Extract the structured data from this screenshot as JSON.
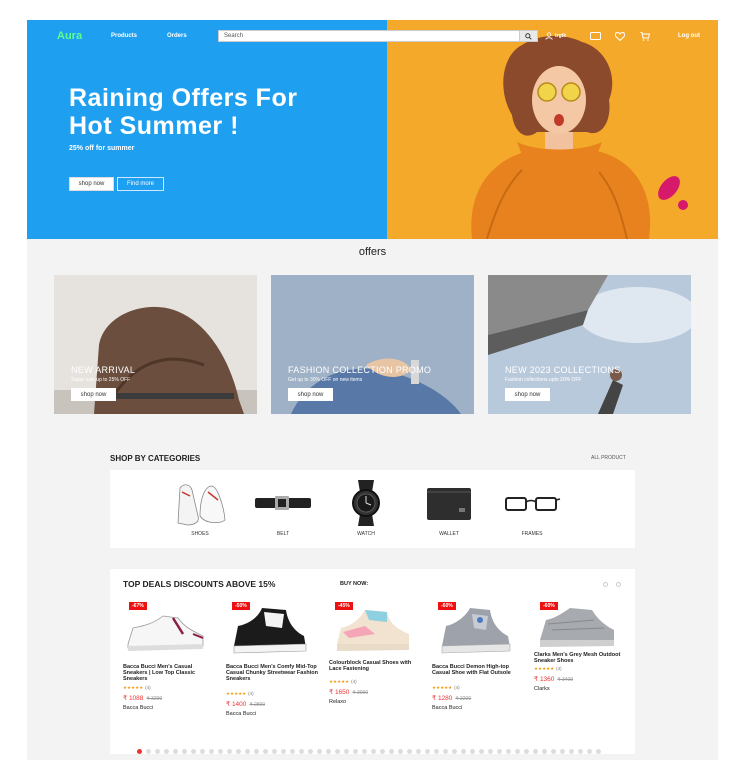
{
  "header": {
    "logo": "Aura",
    "nav": [
      "Products",
      "Orders"
    ],
    "search_placeholder": "Search",
    "user_name": "trgtk",
    "logout": "Log out"
  },
  "hero": {
    "title_line1": "Raining Offers For",
    "title_line2": "Hot Summer !",
    "subtitle": "25% off for summer",
    "shop_button": "shop now",
    "find_button": "Find more"
  },
  "offers": {
    "title": "offers",
    "cards": [
      {
        "heading": "NEW ARRIVAL",
        "sub": "Super sale up to 25% OFF",
        "button": "shop now"
      },
      {
        "heading": "FASHION COLLECTION PROMO",
        "sub": "Get up to 30% OFF on new items",
        "button": "shop now"
      },
      {
        "heading": "NEW 2023 COLLECTIONS",
        "sub": "Fashion collections upto 20% OFF",
        "button": "shop now"
      }
    ]
  },
  "categories": {
    "title": "SHOP BY CATEGORIES",
    "all_link": "ALL PRODUCT",
    "items": [
      "SHOES",
      "BELT",
      "WATCH",
      "WALLET",
      "FRAMES"
    ]
  },
  "deals": {
    "title": "TOP DEALS DISCOUNTS ABOVE 15%",
    "buy_now": "BUY NOW:",
    "products": [
      {
        "discount": "-67%",
        "name": "Bacca Bucci Men's Casual Sneakers | Low Top Classic Sneakers",
        "stars": "★★★★★",
        "reviews": "(4)",
        "price": "₹ 1088",
        "old_price": "₹ 3299",
        "brand": "Bacca Bucci"
      },
      {
        "discount": "-50%",
        "name": "Bacca Bucci Men's Comfy Mid-Top Casual Chunky Streetwear Fashion Sneakers",
        "stars": "★★★★★",
        "reviews": "(4)",
        "price": "₹ 1400",
        "old_price": "₹ 2800",
        "brand": "Bacca Bucci"
      },
      {
        "discount": "-45%",
        "name": "Colourblock Casual Shoes with Lace Fastening",
        "stars": "★★★★★",
        "reviews": "(4)",
        "price": "₹ 1650",
        "old_price": "₹ 3000",
        "brand": "Relaxo"
      },
      {
        "discount": "-60%",
        "name": "Bacca Bucci Demon High-top Casual Shoe with Flat Outsole",
        "stars": "★★★★★",
        "reviews": "(4)",
        "price": "₹ 1280",
        "old_price": "₹ 3200",
        "brand": "Bacca Bucci"
      },
      {
        "discount": "-60%",
        "name": "Clarks Men's Grey Mesh Outdoot Sneaker Shoes",
        "stars": "★★★★★",
        "reviews": "(4)",
        "price": "₹ 1360",
        "old_price": "₹ 3400",
        "brand": "Clarks"
      }
    ]
  },
  "colors": {
    "hero_blue": "#1f9ff0",
    "hero_orange": "#f5a92a",
    "logo_green": "#5dff8f",
    "discount_red": "#e11"
  }
}
